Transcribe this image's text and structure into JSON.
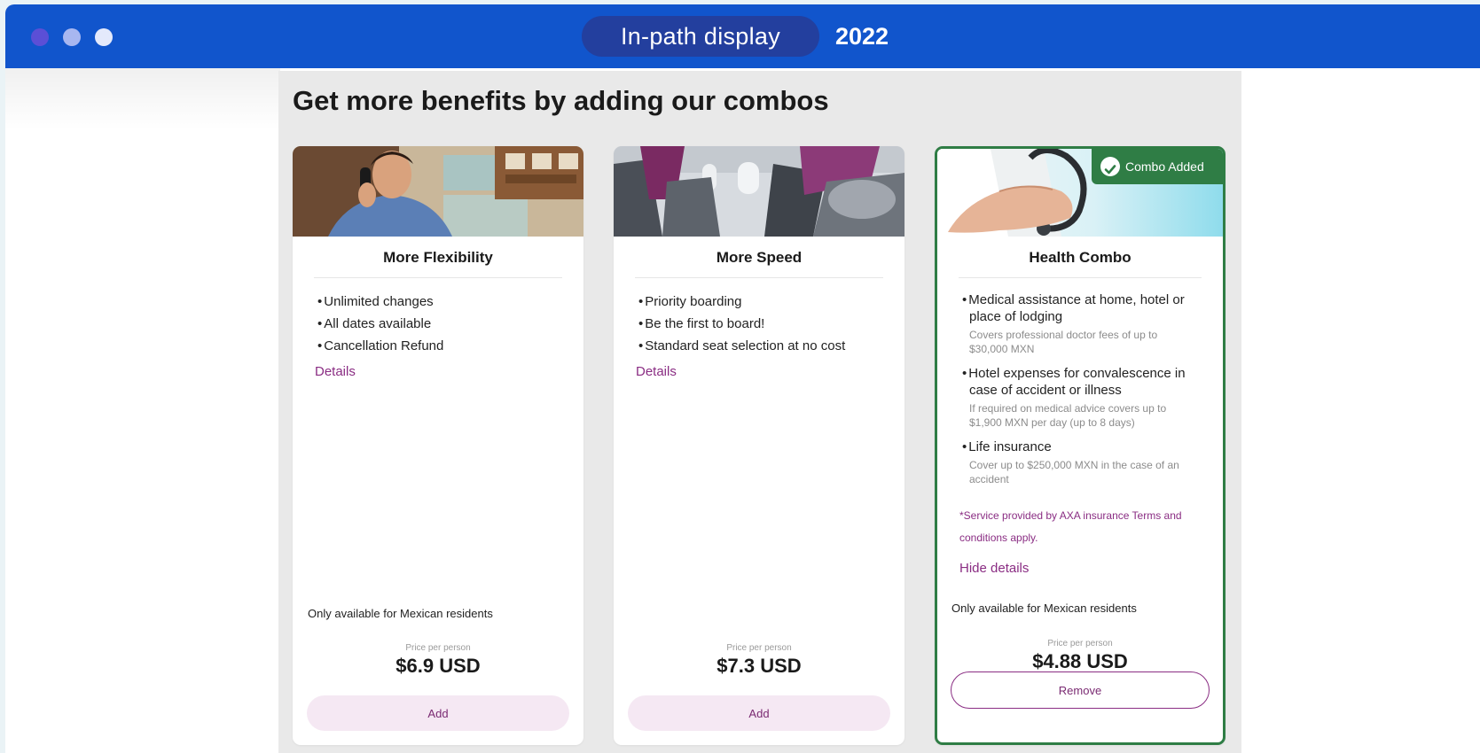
{
  "window": {
    "title": "In-path display",
    "year": "2022"
  },
  "section": {
    "heading": "Get more benefits by adding our combos"
  },
  "cards": [
    {
      "title": "More Flexibility",
      "bullets": [
        "Unlimited changes",
        "All dates available",
        "Cancellation Refund"
      ],
      "details_label": "Details",
      "note": "Only available for Mexican residents",
      "price_caption": "Price per person",
      "price": "$6.9 USD",
      "action_label": "Add"
    },
    {
      "title": "More Speed",
      "bullets": [
        "Priority boarding",
        "Be the first to board!",
        "Standard seat selection at no cost"
      ],
      "details_label": "Details",
      "price_caption": "Price per person",
      "price": "$7.3 USD",
      "action_label": "Add"
    },
    {
      "title": "Health Combo",
      "badge": "Combo Added",
      "items": [
        {
          "text": "Medical assistance at home, hotel or place of lodging",
          "sub": "Covers professional doctor fees of up to $30,000 MXN"
        },
        {
          "text": "Hotel expenses for convalescence in case of accident or illness",
          "sub": "If required on medical advice covers up to $1,900 MXN per day (up to 8 days)"
        },
        {
          "text": "Life insurance",
          "sub": "Cover up to $250,000 MXN in the case of an accident"
        }
      ],
      "disclaimer": "*Service provided by AXA insurance Terms and conditions apply.",
      "hide_details_label": "Hide details",
      "note": "Only available for Mexican residents",
      "price_caption": "Price per person",
      "price": "$4.88 USD",
      "action_label": "Remove"
    }
  ],
  "colors": {
    "titlebar": "#1155cc",
    "pill": "#233f9e",
    "accent": "#8a2d83",
    "added_green": "#2f7d45"
  }
}
